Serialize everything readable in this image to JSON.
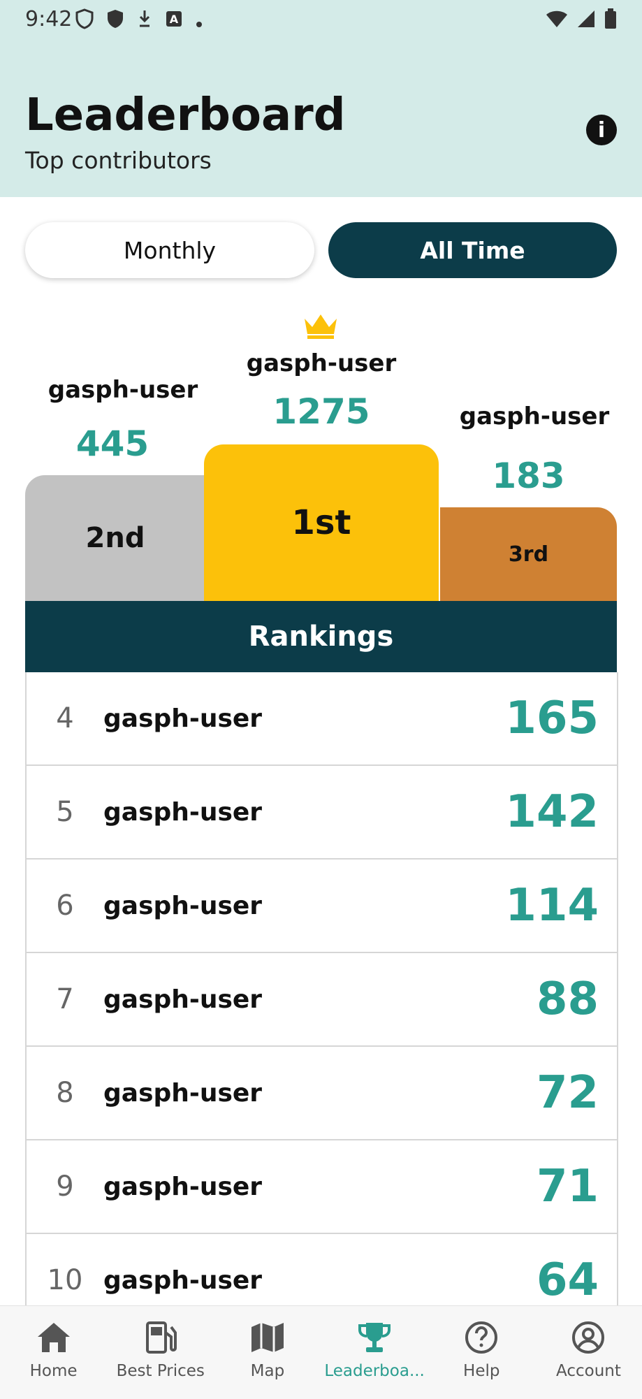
{
  "status_bar": {
    "time": "9:42"
  },
  "header": {
    "title": "Leaderboard",
    "subtitle": "Top contributors",
    "info_icon": "info-icon"
  },
  "tabs": {
    "monthly_label": "Monthly",
    "all_time_label": "All Time",
    "selected": "All Time"
  },
  "podium": {
    "first": {
      "name": "gasph-user",
      "score": "1275",
      "label": "1st"
    },
    "second": {
      "name": "gasph-user",
      "score": "445",
      "label": "2nd"
    },
    "third": {
      "name": "gasph-user",
      "score": "183",
      "label": "3rd"
    }
  },
  "rankings": {
    "title": "Rankings",
    "rows": [
      {
        "rank": "4",
        "name": "gasph-user",
        "score": "165"
      },
      {
        "rank": "5",
        "name": "gasph-user",
        "score": "142"
      },
      {
        "rank": "6",
        "name": "gasph-user",
        "score": "114"
      },
      {
        "rank": "7",
        "name": "gasph-user",
        "score": "88"
      },
      {
        "rank": "8",
        "name": "gasph-user",
        "score": "72"
      },
      {
        "rank": "9",
        "name": "gasph-user",
        "score": "71"
      },
      {
        "rank": "10",
        "name": "gasph-user",
        "score": "64"
      }
    ]
  },
  "nav": {
    "items": [
      {
        "label": "Home",
        "icon": "home-icon"
      },
      {
        "label": "Best Prices",
        "icon": "fuel-pump-icon"
      },
      {
        "label": "Map",
        "icon": "map-icon"
      },
      {
        "label": "Leaderboa...",
        "icon": "trophy-icon"
      },
      {
        "label": "Help",
        "icon": "help-icon"
      },
      {
        "label": "Account",
        "icon": "account-icon"
      }
    ],
    "active_index": 3
  },
  "colors": {
    "header_bg": "#d4ebe8",
    "accent": "#2a9d8f",
    "dark_teal": "#0c3c49",
    "gold": "#fcc10a",
    "silver": "#c2c2c2",
    "bronze": "#cf8133"
  }
}
